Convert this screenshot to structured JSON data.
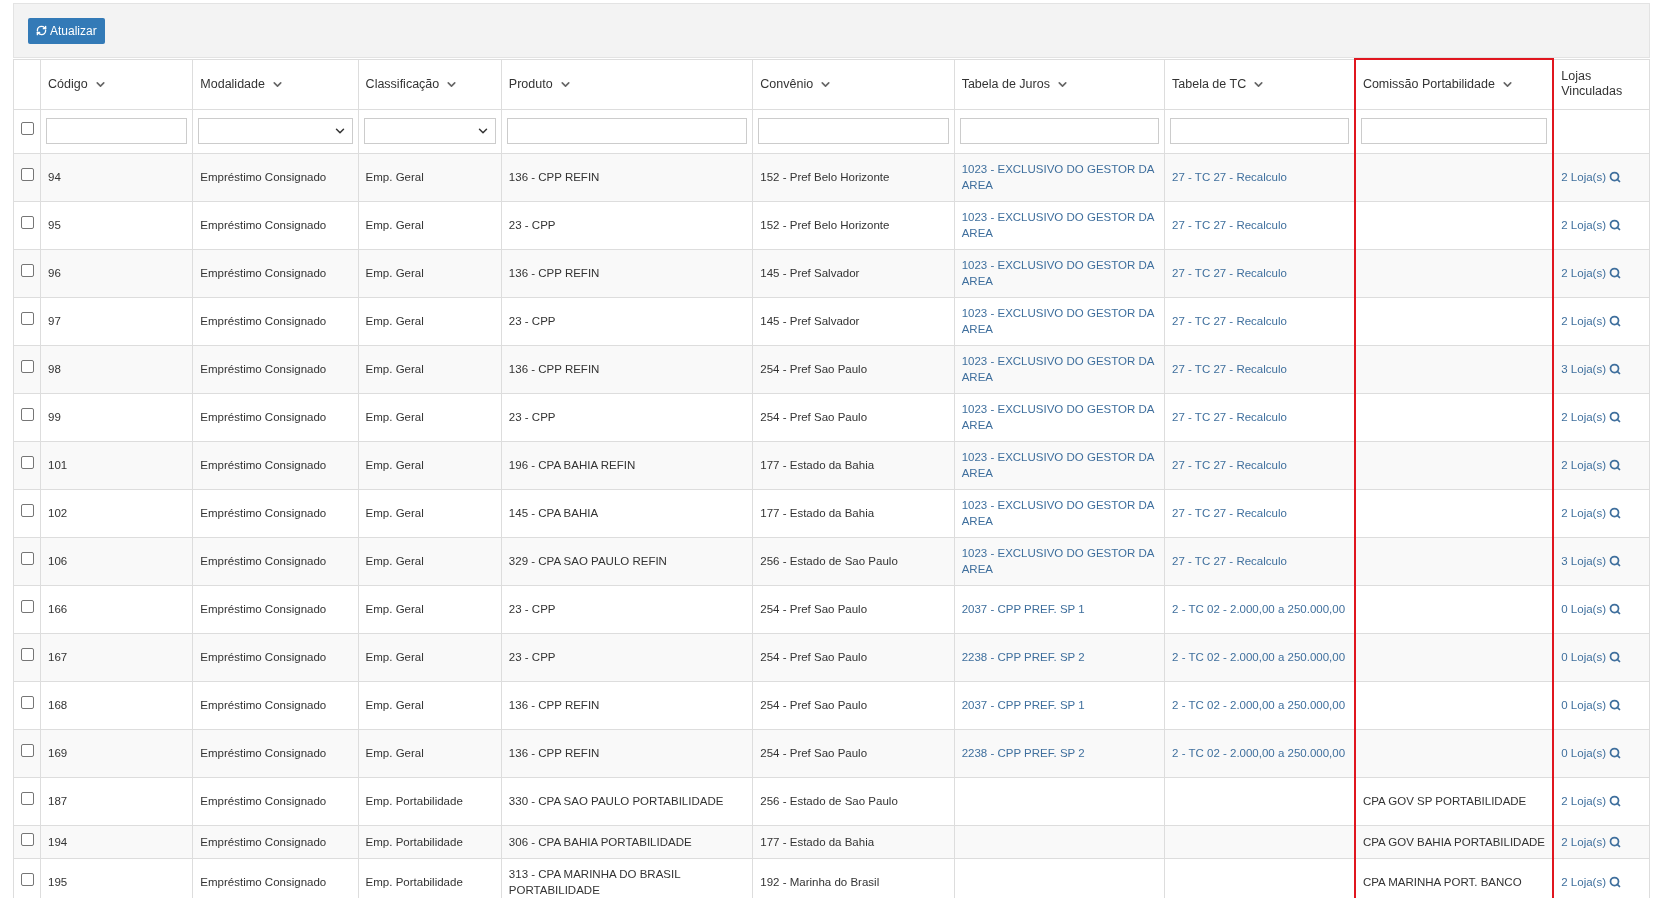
{
  "toolbar": {
    "refresh_button": "Atualizar"
  },
  "table": {
    "select_all": {
      "checked": false
    },
    "columns": [
      {
        "label": "Código",
        "sortable": true,
        "filter": {
          "kind": "text"
        }
      },
      {
        "label": "Modalidade",
        "sortable": true,
        "filter": {
          "kind": "select"
        }
      },
      {
        "label": "Classificação",
        "sortable": true,
        "filter": {
          "kind": "select"
        }
      },
      {
        "label": "Produto",
        "sortable": true,
        "filter": {
          "kind": "text"
        }
      },
      {
        "label": "Convênio",
        "sortable": true,
        "filter": {
          "kind": "text"
        }
      },
      {
        "label": "Tabela de Juros",
        "sortable": true,
        "filter": {
          "kind": "text"
        }
      },
      {
        "label": "Tabela de TC",
        "sortable": true,
        "filter": {
          "kind": "text"
        }
      },
      {
        "label": "Comissão Portabilidade",
        "sortable": true,
        "filter": {
          "kind": "text"
        },
        "highlighted": true
      },
      {
        "label": "Lojas Vinculadas",
        "sortable": false
      }
    ],
    "rows": [
      {
        "checked": false,
        "cells": [
          "94",
          "Empréstimo Consignado",
          "Emp. Geral",
          "136 - CPP REFIN",
          "152 - Pref Belo Horizonte",
          "1023 - EXCLUSIVO DO GESTOR DA AREA",
          "27 - TC 27 - Recalculo",
          "",
          "2 Loja(s)"
        ]
      },
      {
        "checked": false,
        "cells": [
          "95",
          "Empréstimo Consignado",
          "Emp. Geral",
          "23 - CPP",
          "152 - Pref Belo Horizonte",
          "1023 - EXCLUSIVO DO GESTOR DA AREA",
          "27 - TC 27 - Recalculo",
          "",
          "2 Loja(s)"
        ]
      },
      {
        "checked": false,
        "cells": [
          "96",
          "Empréstimo Consignado",
          "Emp. Geral",
          "136 - CPP REFIN",
          "145 - Pref Salvador",
          "1023 - EXCLUSIVO DO GESTOR DA AREA",
          "27 - TC 27 - Recalculo",
          "",
          "2 Loja(s)"
        ]
      },
      {
        "checked": false,
        "cells": [
          "97",
          "Empréstimo Consignado",
          "Emp. Geral",
          "23 - CPP",
          "145 - Pref Salvador",
          "1023 - EXCLUSIVO DO GESTOR DA AREA",
          "27 - TC 27 - Recalculo",
          "",
          "2 Loja(s)"
        ]
      },
      {
        "checked": false,
        "cells": [
          "98",
          "Empréstimo Consignado",
          "Emp. Geral",
          "136 - CPP REFIN",
          "254 - Pref Sao Paulo",
          "1023 - EXCLUSIVO DO GESTOR DA AREA",
          "27 - TC 27 - Recalculo",
          "",
          "3 Loja(s)"
        ]
      },
      {
        "checked": false,
        "cells": [
          "99",
          "Empréstimo Consignado",
          "Emp. Geral",
          "23 - CPP",
          "254 - Pref Sao Paulo",
          "1023 - EXCLUSIVO DO GESTOR DA AREA",
          "27 - TC 27 - Recalculo",
          "",
          "2 Loja(s)"
        ]
      },
      {
        "checked": false,
        "cells": [
          "101",
          "Empréstimo Consignado",
          "Emp. Geral",
          "196 - CPA BAHIA REFIN",
          "177 - Estado da Bahia",
          "1023 - EXCLUSIVO DO GESTOR DA AREA",
          "27 - TC 27 - Recalculo",
          "",
          "2 Loja(s)"
        ]
      },
      {
        "checked": false,
        "cells": [
          "102",
          "Empréstimo Consignado",
          "Emp. Geral",
          "145 - CPA BAHIA",
          "177 - Estado da Bahia",
          "1023 - EXCLUSIVO DO GESTOR DA AREA",
          "27 - TC 27 - Recalculo",
          "",
          "2 Loja(s)"
        ]
      },
      {
        "checked": false,
        "cells": [
          "106",
          "Empréstimo Consignado",
          "Emp. Geral",
          "329 - CPA SAO PAULO REFIN",
          "256 - Estado de Sao Paulo",
          "1023 - EXCLUSIVO DO GESTOR DA AREA",
          "27 - TC 27 - Recalculo",
          "",
          "3 Loja(s)"
        ]
      },
      {
        "checked": false,
        "cells": [
          "166",
          "Empréstimo Consignado",
          "Emp. Geral",
          "23 - CPP",
          "254 - Pref Sao Paulo",
          "2037 - CPP PREF. SP 1",
          "2 - TC 02 - 2.000,00 a 250.000,00",
          "",
          "0 Loja(s)"
        ]
      },
      {
        "checked": false,
        "cells": [
          "167",
          "Empréstimo Consignado",
          "Emp. Geral",
          "23 - CPP",
          "254 - Pref Sao Paulo",
          "2238 - CPP PREF. SP 2",
          "2 - TC 02 - 2.000,00 a 250.000,00",
          "",
          "0 Loja(s)"
        ]
      },
      {
        "checked": false,
        "cells": [
          "168",
          "Empréstimo Consignado",
          "Emp. Geral",
          "136 - CPP REFIN",
          "254 - Pref Sao Paulo",
          "2037 - CPP PREF. SP 1",
          "2 - TC 02 - 2.000,00 a 250.000,00",
          "",
          "0 Loja(s)"
        ]
      },
      {
        "checked": false,
        "cells": [
          "169",
          "Empréstimo Consignado",
          "Emp. Geral",
          "136 - CPP REFIN",
          "254 - Pref Sao Paulo",
          "2238 - CPP PREF. SP 2",
          "2 - TC 02 - 2.000,00 a 250.000,00",
          "",
          "0 Loja(s)"
        ]
      },
      {
        "checked": false,
        "cells": [
          "187",
          "Empréstimo Consignado",
          "Emp. Portabilidade",
          "330 - CPA SAO PAULO PORTABILIDADE",
          "256 - Estado de Sao Paulo",
          "",
          "",
          "CPA GOV SP PORTABILIDADE",
          "2 Loja(s)"
        ]
      },
      {
        "checked": false,
        "cells": [
          "194",
          "Empréstimo Consignado",
          "Emp. Portabilidade",
          "306 - CPA BAHIA PORTABILIDADE",
          "177 - Estado da Bahia",
          "",
          "",
          "CPA GOV BAHIA PORTABILIDADE",
          "2 Loja(s)"
        ]
      },
      {
        "checked": false,
        "cells": [
          "195",
          "Empréstimo Consignado",
          "Emp. Portabilidade",
          "313 - CPA MARINHA DO BRASIL PORTABILIDADE",
          "192 - Marinha do Brasil",
          "",
          "",
          "CPA MARINHA PORT. BANCO",
          "2 Loja(s)"
        ]
      }
    ]
  }
}
